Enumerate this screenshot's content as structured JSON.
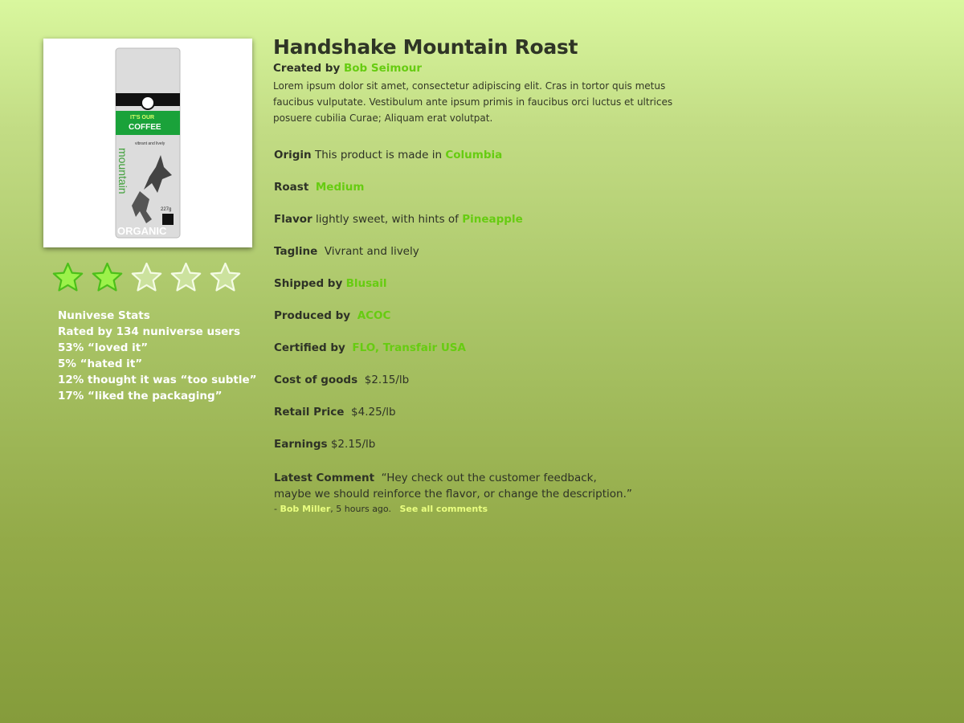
{
  "product": {
    "title": "Handshake Mountain Roast",
    "created_by_label": "Created by",
    "creator": "Bob Seimour",
    "description": "Lorem ipsum dolor sit amet, consectetur adipiscing elit. Cras in tortor quis metus faucibus vulputate. Vestibulum ante ipsum primis in faucibus orci luctus et ultrices posuere cubilia Curae; Aliquam erat volutpat."
  },
  "image": {
    "brand_line": "IT'S OUR",
    "band_text": "COFFEE",
    "subtitle": "vibrant and lively",
    "vertical_text": "mountain",
    "weight": "227g",
    "bottom_text": "ORGANIC",
    "icon": "coffee-bag-icon"
  },
  "rating": {
    "value": 2,
    "max": 5,
    "icon": "star-icon",
    "filled_color": "#9cf24a",
    "empty_color": "#e4f5c6"
  },
  "stats": {
    "heading": "Nunivese Stats",
    "lines": [
      "Rated by 134 nuniverse users",
      "53% “loved it”",
      "5% “hated it”",
      "12% thought it was “too subtle”",
      "17% “liked the packaging”"
    ]
  },
  "details": {
    "origin": {
      "label": "Origin",
      "text": "This product is made in",
      "value": "Columbia"
    },
    "roast": {
      "label": "Roast",
      "value": "Medium"
    },
    "flavor": {
      "label": "Flavor",
      "text": "lightly sweet,  with hints of",
      "value": "Pineapple"
    },
    "tagline": {
      "label": "Tagline",
      "text": "Vivrant and lively"
    },
    "shipped_by": {
      "label": "Shipped by",
      "value": "Blusail"
    },
    "produced_by": {
      "label": "Produced by",
      "value": "ACOC"
    },
    "certified_by": {
      "label": "Certified by",
      "value": "FLO, Transfair USA"
    },
    "cost": {
      "label": "Cost of goods",
      "value": "$2.15/lb"
    },
    "retail": {
      "label": "Retail Price",
      "value": "$4.25/lb"
    },
    "earnings": {
      "label": "Earnings",
      "value": "$2.15/lb"
    }
  },
  "comment": {
    "label": "Latest Comment",
    "line1": "“Hey check out the customer feedback,",
    "line2": "maybe we should reinforce the flavor, or change the description.”",
    "dash": "-",
    "author": "Bob Miller",
    "time": ", 5 hours ago.",
    "see_all": "See all comments"
  },
  "colors": {
    "accent_green": "#66cc11",
    "meta_link": "#eaff80",
    "text_dark": "#2e3226"
  }
}
